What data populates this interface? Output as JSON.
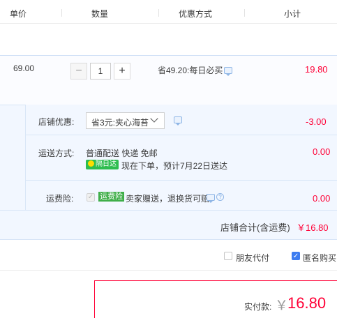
{
  "header": {
    "columns": [
      "单价",
      "数量",
      "优惠方式",
      "小计"
    ]
  },
  "item": {
    "unit_price": "69.00",
    "quantity": "1",
    "minus_glyph": "−",
    "plus_glyph": "+",
    "discount_text": "省49.20:每日必买",
    "subtotal": "19.80"
  },
  "shop": {
    "coupon_label": "店铺优惠:",
    "coupon_selected": "省3元:夹心海苔",
    "coupon_amount": "-3.00",
    "shipping_label": "运送方式:",
    "shipping_text": "普通配送 快递 免邮",
    "shipping_badge": "隔日达",
    "shipping_eta": "现在下单，预计7月22日送达",
    "shipping_amount": "0.00",
    "insurance_label": "运费险:",
    "insurance_badge": "运费险",
    "insurance_text": "卖家赠送，退换货可赔",
    "insurance_amount": "0.00",
    "total_label": "店铺合计(含运费)",
    "total_amount": "￥16.80"
  },
  "options": {
    "friend_pay_label": "朋友代付",
    "anonymous_label": "匿名购买"
  },
  "payment": {
    "label": "实付款:",
    "currency": "￥",
    "amount": "16.80"
  },
  "colors": {
    "price_red": "#ff0036",
    "accent_blue": "#3c7cf0",
    "badge_green": "#2ebd4f",
    "shop_bg": "#f2f7ff"
  }
}
